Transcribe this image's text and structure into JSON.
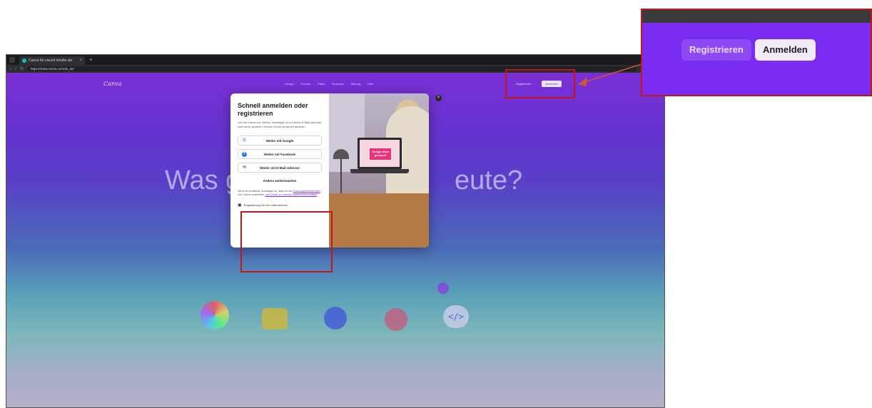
{
  "browser": {
    "tab_title": "Canva für visuell Inhalte als",
    "tab_close": "×",
    "new_tab": "+",
    "url": "https://www.canva.com/de_de/",
    "back": "‹",
    "forward": "›",
    "reload": "↻"
  },
  "site": {
    "logo": "Canva",
    "nav": [
      "Design",
      "Produkt",
      "Pläne",
      "Business",
      "Bildung",
      "Hilfe"
    ],
    "register": "Registrieren",
    "login": "Anmelden",
    "hero_left": "Was g",
    "hero_right": "eute?",
    "code_icon": "</>"
  },
  "modal": {
    "title": "Schnell anmelden oder registrieren",
    "description": "Um mit Canva fort. Aktivis, handlegst du nur deine E-Mail-Adresse oder einen anderen Service-Konto ist aktuell anderen.",
    "google": "Weiter mit Google",
    "facebook": "Weiter mit Facebook",
    "email": "Weiter mit E-Mail-Adresse",
    "other": "Andere weitermachen",
    "terms_text": "Wenn du fortfährst, bestätigst du, dass du der",
    "terms_link": "Nutzungsbedingungen",
    "terms_middle": "von Canva zustimmst.",
    "privacy_link": "Lies Endet zu unserer Datenschutzrichtlinie",
    "company": "Registrierung für ein Unternehmen",
    "display_text": "Design lässt gemacht",
    "close": "×",
    "google_glyph": "G",
    "facebook_glyph": "f",
    "email_glyph": "✉",
    "company_glyph": "▣"
  },
  "zoom": {
    "register": "Registrieren",
    "login": "Anmelden"
  },
  "colors": {
    "highlight": "#c01818",
    "canva_purple": "#7a2cf0"
  }
}
